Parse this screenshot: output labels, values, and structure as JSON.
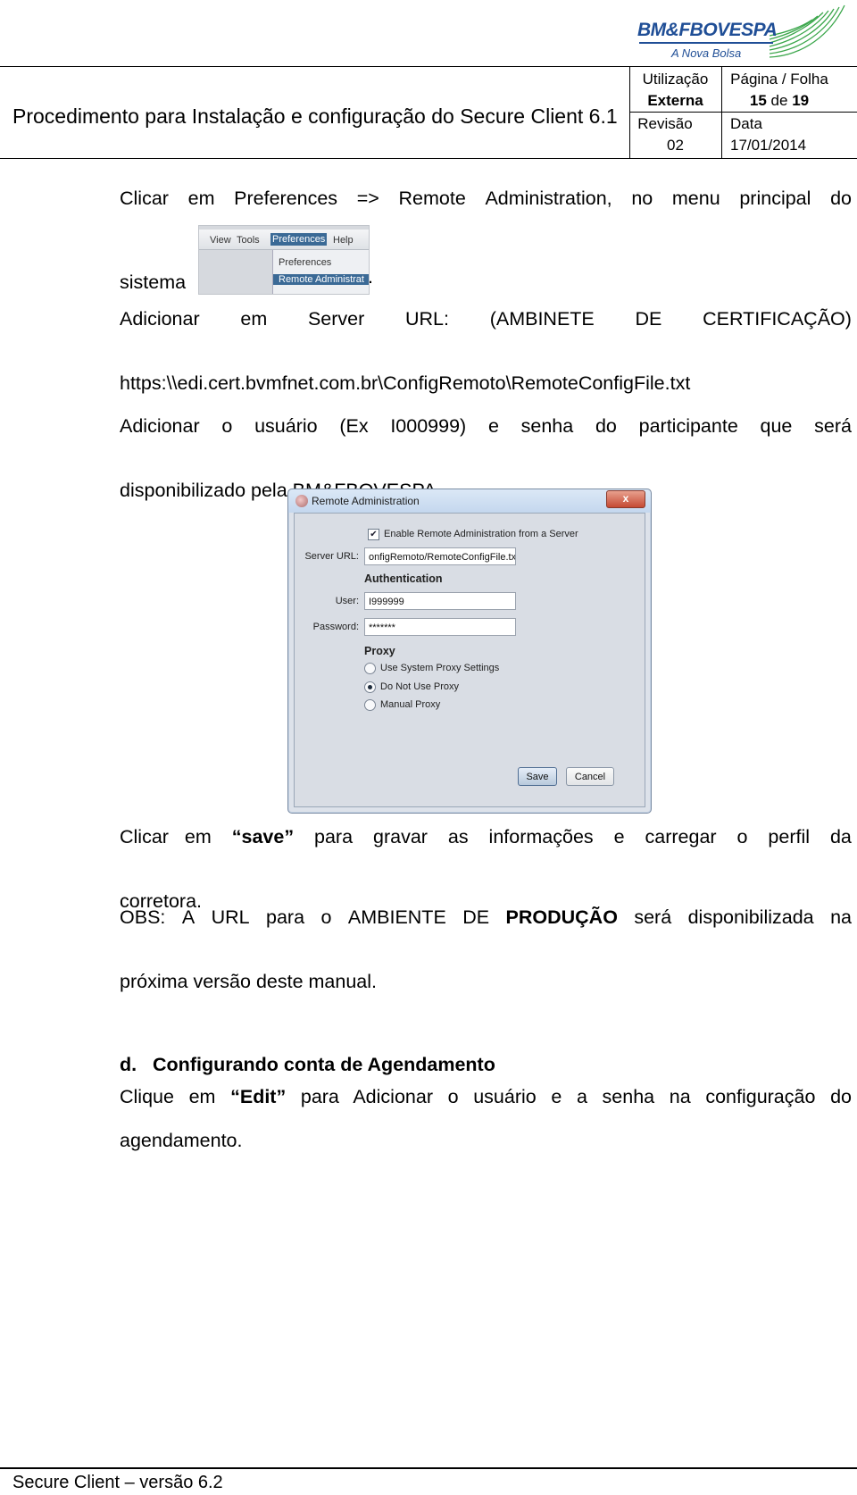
{
  "logo": {
    "name": "BM&FBOVESPA",
    "tagline": "A Nova Bolsa"
  },
  "header": {
    "title": "Procedimento para Instalação e configuração do Secure Client 6.1",
    "usage_label": "Utilização",
    "usage_value": "Externa",
    "page_label": "Página / Folha",
    "page_current": "15",
    "page_sep": "de",
    "page_total": "19",
    "revision_label": "Revisão",
    "revision_value": "02",
    "date_label": "Data",
    "date_value": "17/01/2014"
  },
  "body": {
    "p1_line1_words": [
      "Clicar",
      "em",
      "Preferences",
      "=>",
      "Remote",
      "Administration,",
      "no",
      "menu",
      "principal",
      "do"
    ],
    "p1_line2_start": "sistema",
    "p1_line2_end": ".",
    "menu_snippet": {
      "menu_items": [
        "View",
        "Tools",
        "Preferences",
        "Help"
      ],
      "active_menu": "Preferences",
      "dropdown_items": [
        "Preferences",
        "Remote Administrat"
      ],
      "selected_item": "Remote Administrat"
    },
    "p2_line1_words": [
      "Adicionar",
      "em",
      "Server",
      "URL:",
      "(AMBINETE",
      "DE",
      "CERTIFICAÇÃO)"
    ],
    "p2_line2": "https:\\\\edi.cert.bvmfnet.com.br\\ConfigRemoto\\RemoteConfigFile.txt",
    "p3_line1_words": [
      "Adicionar",
      "o",
      "usuário",
      "(Ex",
      "I000999)",
      "e",
      "senha",
      "do",
      "participante",
      "que",
      "será"
    ],
    "p3_line2": "disponibilizado pela BM&FBOVESPA.",
    "p4_line1_pre": "Clicar em",
    "p4_line1_bold": "“save”",
    "p4_line1_post_words": [
      "para",
      "gravar",
      "as",
      "informações",
      "e",
      "carregar",
      "o",
      "perfil",
      "da"
    ],
    "p4_line2": "corretora.",
    "p5_line1_pre_words": [
      "OBS:",
      "A",
      "URL",
      "para",
      "o",
      "AMBIENTE",
      "DE"
    ],
    "p5_line1_bold": "PRODUÇÃO",
    "p5_line1_post_words": [
      "será",
      "disponibilizada",
      "na"
    ],
    "p5_line2": "próxima versão deste manual.",
    "section_heading": "d.   Configurando conta de Agendamento",
    "p6_line1_pre": "Clique em",
    "p6_line1_bold": "“Edit”",
    "p6_line1_post": "para Adicionar o usuário e a senha na configuração do",
    "p6_line2": "agendamento."
  },
  "dialog": {
    "title": "Remote Administration",
    "close_glyph": "x",
    "enable_checkbox_label": "Enable Remote Administration from a Server",
    "enable_checked": true,
    "check_glyph": "✔",
    "server_url_label": "Server URL:",
    "server_url_value": "onfigRemoto/RemoteConfigFile.txt",
    "auth_heading": "Authentication",
    "user_label": "User:",
    "user_value": "I999999",
    "password_label": "Password:",
    "password_value": "*******",
    "proxy_heading": "Proxy",
    "proxy_options": [
      "Use System Proxy Settings",
      "Do Not Use Proxy",
      "Manual Proxy"
    ],
    "proxy_selected": "Do Not Use Proxy",
    "save_label": "Save",
    "cancel_label": "Cancel"
  },
  "footer": {
    "text": "Secure Client – versão 6.2"
  },
  "colors": {
    "brand_blue": "#1f4e96",
    "brand_green": "#3aa64a",
    "menu_highlight": "#3b6a96"
  }
}
